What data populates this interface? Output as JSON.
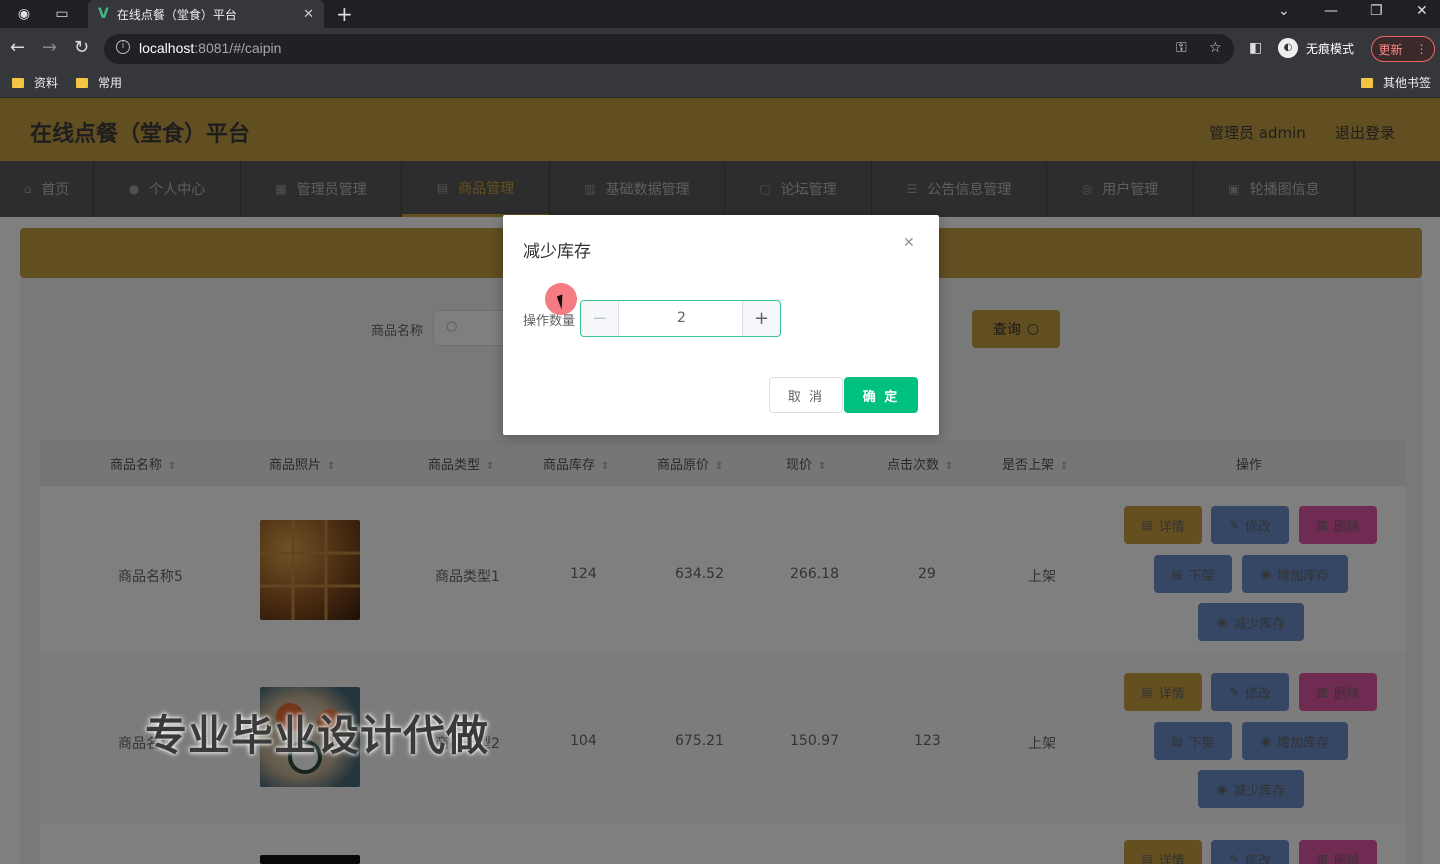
{
  "browser": {
    "tab_title": "在线点餐（堂食）平台",
    "url_host": "localhost",
    "url_rest": ":8081/#/caipin",
    "incognito_label": "无痕模式",
    "update_label": "更新",
    "bookmarks": [
      "资料",
      "常用"
    ],
    "other_bookmarks": "其他书签"
  },
  "header": {
    "title": "在线点餐（堂食）平台",
    "user": "管理员 admin",
    "logout": "退出登录"
  },
  "nav": {
    "items": [
      {
        "label": "首页"
      },
      {
        "label": "个人中心"
      },
      {
        "label": "管理员管理"
      },
      {
        "label": "商品管理"
      },
      {
        "label": "基础数据管理"
      },
      {
        "label": "论坛管理"
      },
      {
        "label": "公告信息管理"
      },
      {
        "label": "用户管理"
      },
      {
        "label": "轮播图信息"
      }
    ]
  },
  "search": {
    "label": "商品名称",
    "button": "查询"
  },
  "table": {
    "columns": [
      "商品名称",
      "商品照片",
      "商品类型",
      "商品库存",
      "商品原价",
      "现价",
      "点击次数",
      "是否上架",
      "操作"
    ],
    "rows": [
      {
        "name": "商品名称5",
        "type": "商品类型1",
        "stock": "124",
        "original_price": "634.52",
        "price": "266.18",
        "clicks": "29",
        "status": "上架"
      },
      {
        "name": "商品名称",
        "type": "商品类型2",
        "stock": "104",
        "original_price": "675.21",
        "price": "150.97",
        "clicks": "123",
        "status": "上架"
      }
    ],
    "actions": {
      "detail": "详情",
      "edit": "修改",
      "delete": "删除",
      "off_shelf": "下架",
      "add_stock": "增加库存",
      "reduce_stock": "减少库存"
    }
  },
  "watermark": "专业毕业设计代做",
  "dialog": {
    "title": "减少库存",
    "field_label": "操作数量",
    "value": "2",
    "cancel": "取 消",
    "confirm": "确 定"
  },
  "colors": {
    "brand": "#c39d42",
    "confirm": "#00c07f",
    "delete": "#e056a6",
    "secondary": "#6b8ec8"
  }
}
